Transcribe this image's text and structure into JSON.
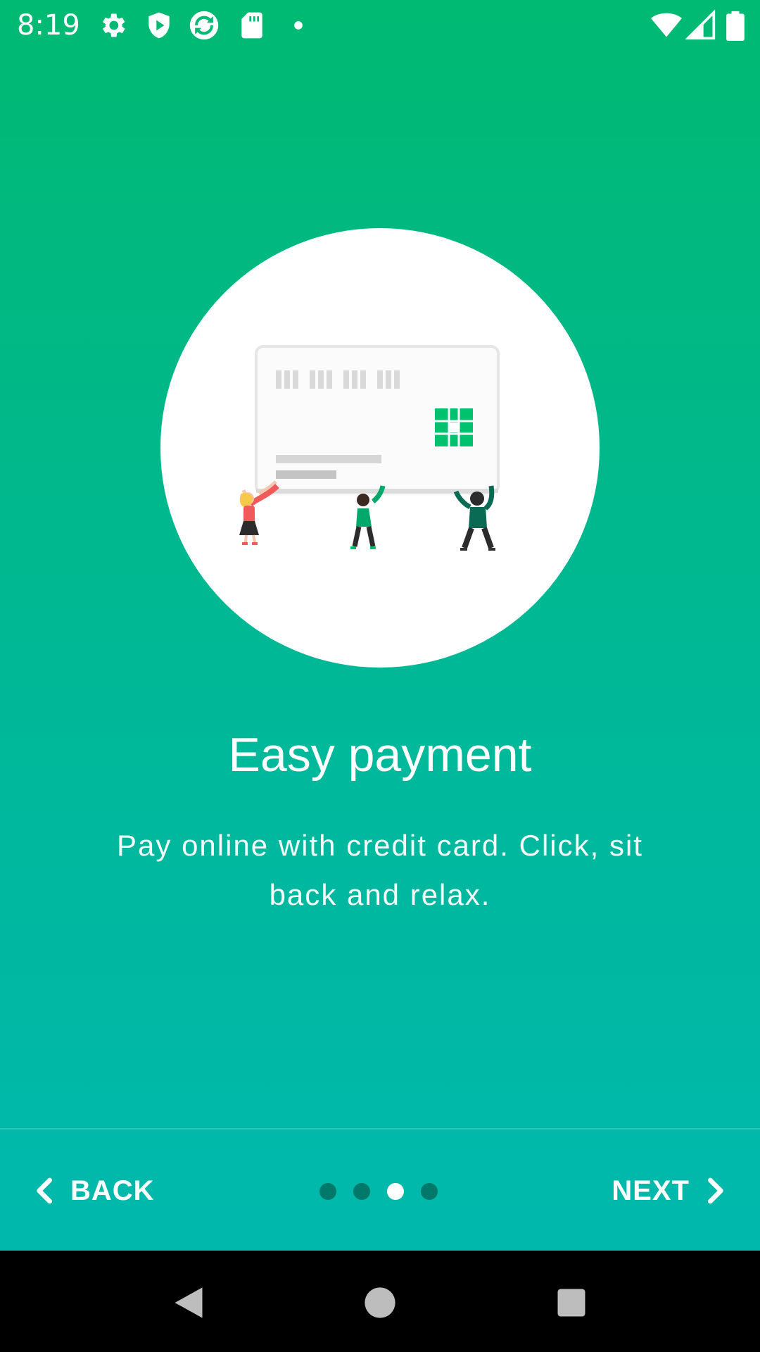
{
  "status_bar": {
    "time": "8:19",
    "left_icons": [
      "settings-gear-icon",
      "shield-play-icon",
      "sync-app-icon",
      "sd-card-icon",
      "notification-dot-icon"
    ],
    "right_icons": [
      "wifi-icon",
      "cell-signal-icon",
      "battery-icon"
    ]
  },
  "onboarding": {
    "title": "Easy payment",
    "description": "Pay online with credit card. Click, sit back and relax.",
    "illustration": "credit-card-people-illustration",
    "current_page": 3,
    "page_count": 4
  },
  "navigation": {
    "back_label": "BACK",
    "next_label": "NEXT"
  },
  "colors": {
    "gradient_top": "#00b972",
    "gradient_bottom": "#00b9ad",
    "accent_green": "#00c16e",
    "dot_inactive": "#00796b",
    "dot_active": "#ffffff"
  },
  "system_nav": [
    "back-triangle-icon",
    "home-circle-icon",
    "recents-square-icon"
  ]
}
